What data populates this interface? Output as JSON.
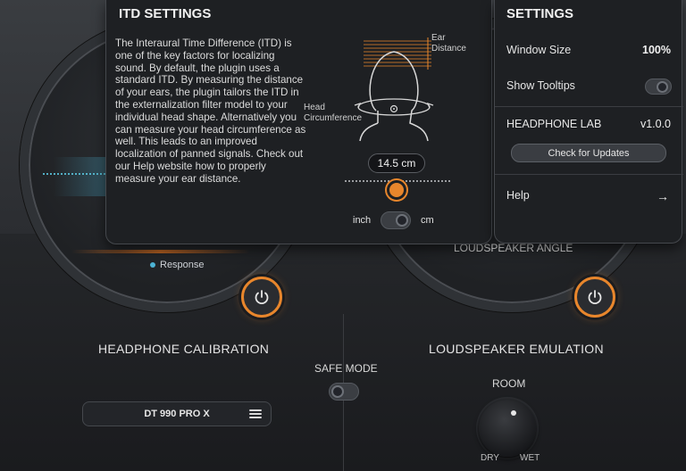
{
  "itd": {
    "title": "ITD SETTINGS",
    "description": "The Interaural Time Difference (ITD) is one of the key factors for localizing sound. By default, the plugin uses a standard ITD. By measuring the distance of your ears, the plugin tailors the ITD in the externalization filter model to your individual head shape. Alternatively you can measure your head circumference as well. This leads to an improved localization of panned signals. Check out our Help website how to properly measure your ear distance.",
    "ear_distance_label_1": "Ear",
    "ear_distance_label_2": "Distance",
    "head_circ_label_1": "Head",
    "head_circ_label_2": "Circumference",
    "value": "14.5 cm",
    "unit_left": "inch",
    "unit_right": "cm",
    "unit_selected": "cm"
  },
  "settings": {
    "title": "SETTINGS",
    "window_size_label": "Window Size",
    "window_size_value": "100%",
    "tooltips_label": "Show Tooltips",
    "tooltips_on": false,
    "product_label": "HEADPHONE LAB",
    "version": "v1.0.0",
    "update_button": "Check for Updates",
    "help_label": "Help",
    "help_arrow": "→"
  },
  "main": {
    "legend_response": "Response",
    "loudspeaker_angle": "LOUDSPEAKER ANGLE",
    "headphone_calibration": "HEADPHONE CALIBRATION",
    "loudspeaker_emulation": "LOUDSPEAKER EMULATION",
    "safe_mode": "SAFE MODE",
    "preset": "DT 990 PRO X",
    "room": "ROOM",
    "dry": "DRY",
    "wet": "WET"
  },
  "colors": {
    "accent": "#e8862c",
    "response": "#4cb3d4",
    "panel_bg": "#1e2023"
  }
}
